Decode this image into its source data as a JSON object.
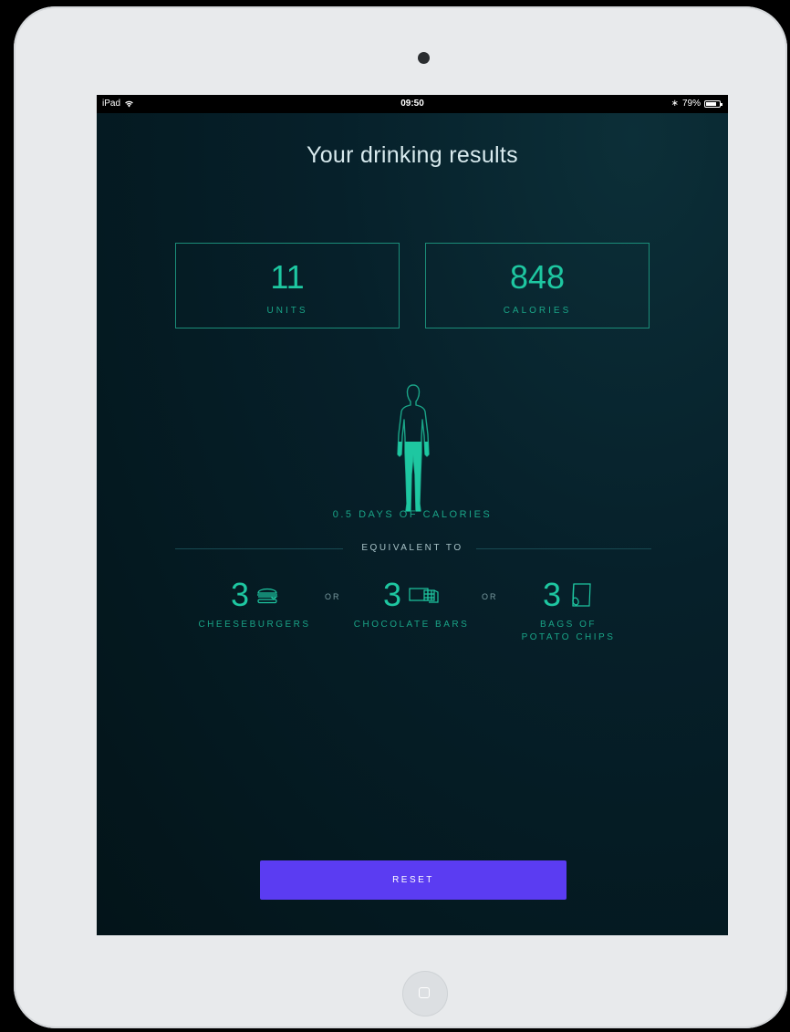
{
  "status_bar": {
    "device": "iPad",
    "time": "09:50",
    "battery": "79%",
    "battery_level": 0.79
  },
  "results": {
    "title": "Your drinking results",
    "units": {
      "value": "11",
      "label": "UNITS"
    },
    "calories": {
      "value": "848",
      "label": "CALORIES"
    },
    "days_label": "0.5 DAYS OF CALORIES",
    "equivalent_label": "EQUIVALENT TO",
    "or_label": "OR",
    "equivalents": [
      {
        "count": "3",
        "name": "CHEESEBURGERS",
        "icon": "cheeseburger-icon"
      },
      {
        "count": "3",
        "name": "CHOCOLATE BARS",
        "icon": "chocolate-bar-icon"
      },
      {
        "count": "3",
        "name_line1": "BAGS OF",
        "name_line2": "POTATO CHIPS",
        "icon": "chips-bag-icon"
      }
    ]
  },
  "reset_button": {
    "label": "RESET"
  },
  "colors": {
    "accent": "#1ec7a1",
    "button": "#5b3cf2",
    "background": "#031419"
  }
}
